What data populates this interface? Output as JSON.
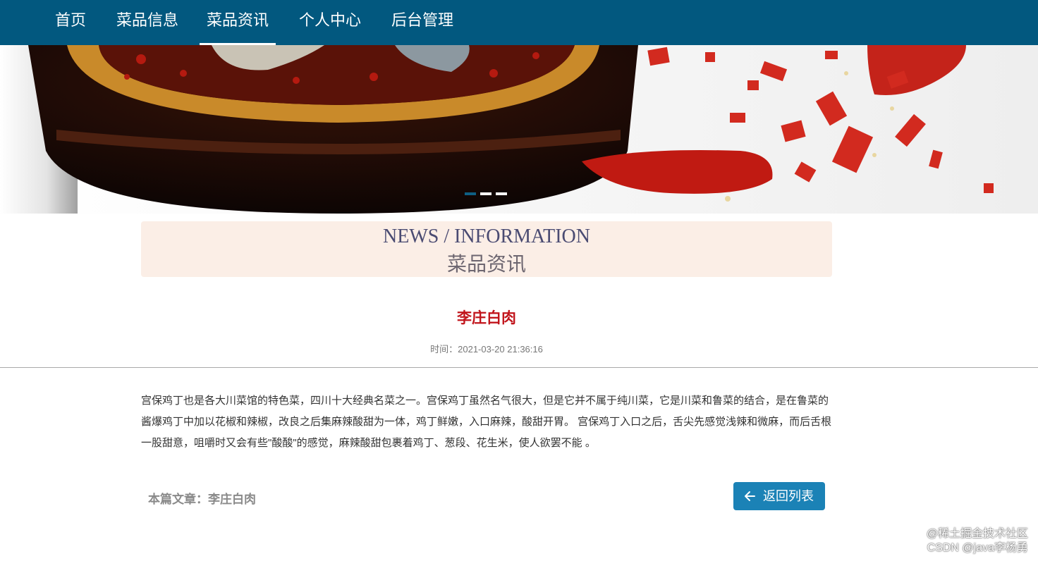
{
  "nav": {
    "items": [
      {
        "label": "首页"
      },
      {
        "label": "菜品信息"
      },
      {
        "label": "菜品资讯"
      },
      {
        "label": "个人中心"
      },
      {
        "label": "后台管理"
      }
    ],
    "active": "菜品资讯",
    "bg_color": "#02587f"
  },
  "banner": {
    "slide_count": 3,
    "active_slide": 1
  },
  "section": {
    "title_en": "NEWS / INFORMATION",
    "title_zh": "菜品资讯"
  },
  "article": {
    "title": "李庄白肉",
    "time_label": "时间：",
    "time_value": "2021-03-20 21:36:16",
    "body": "宫保鸡丁也是各大川菜馆的特色菜，四川十大经典名菜之一。宫保鸡丁虽然名气很大，但是它并不属于纯川菜，它是川菜和鲁菜的结合，是在鲁菜的酱爆鸡丁中加以花椒和辣椒，改良之后集麻辣酸甜为一体，鸡丁鲜嫩，入口麻辣，酸甜开胃。 宫保鸡丁入口之后，舌尖先感觉浅辣和微麻，而后舌根一股甜意，咀嚼时又会有些\"酸酸\"的感觉，麻辣酸甜包裹着鸡丁、葱段、花生米，使人欲罢不能 。"
  },
  "footer": {
    "current_article_label": "本篇文章：李庄白肉",
    "back_button_label": "返回列表",
    "back_icon": "arrow-left-icon"
  },
  "watermark": {
    "line1": "@稀土掘金技术社区",
    "line2": "CSDN @java李杨勇"
  },
  "colors": {
    "accent": "#1b82b6",
    "title_red": "#c1141b",
    "section_bg": "#fbeee6"
  }
}
